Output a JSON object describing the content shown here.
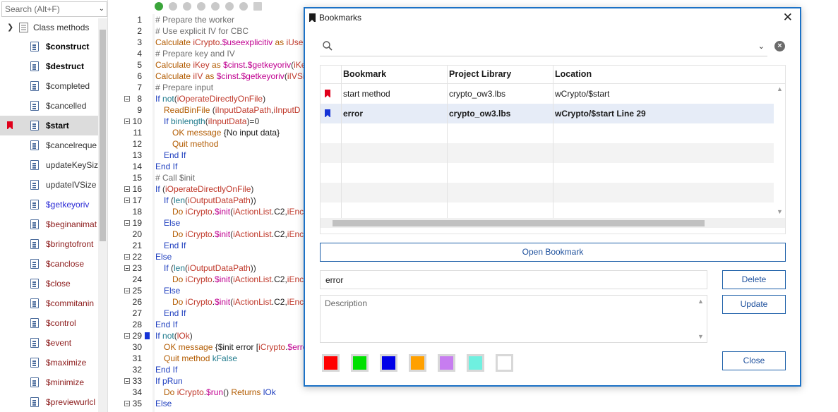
{
  "left_panel": {
    "search_placeholder": "Search (Alt+F)",
    "root_label": "Class methods",
    "items": [
      {
        "label": "$construct",
        "style": "bold"
      },
      {
        "label": "$destruct",
        "style": "bold"
      },
      {
        "label": "$completed",
        "style": "dark"
      },
      {
        "label": "$cancelled",
        "style": "dark"
      },
      {
        "label": "$start",
        "style": "bold",
        "selected": true,
        "bookmark": true
      },
      {
        "label": "$cancelreque",
        "style": "dark"
      },
      {
        "label": "updateKeySiz",
        "style": "dark"
      },
      {
        "label": "updateIVSize",
        "style": "dark"
      },
      {
        "label": "$getkeyoriv",
        "style": "blue"
      },
      {
        "label": "$beginanimat",
        "style": "brown"
      },
      {
        "label": "$bringtofront",
        "style": "brown"
      },
      {
        "label": "$canclose",
        "style": "brown"
      },
      {
        "label": "$close",
        "style": "brown"
      },
      {
        "label": "$commitanin",
        "style": "brown"
      },
      {
        "label": "$control",
        "style": "brown"
      },
      {
        "label": "$event",
        "style": "brown"
      },
      {
        "label": "$maximize",
        "style": "brown"
      },
      {
        "label": "$minimize",
        "style": "brown"
      },
      {
        "label": "$previewurlcl",
        "style": "brown"
      }
    ]
  },
  "editor": {
    "lines": [
      {
        "n": "1",
        "fold": false,
        "indent": 0,
        "tokens": [
          [
            "cm",
            "# Prepare the worker"
          ]
        ]
      },
      {
        "n": "2",
        "fold": false,
        "indent": 0,
        "tokens": [
          [
            "cm",
            "# Use explicit IV for CBC"
          ]
        ]
      },
      {
        "n": "3",
        "fold": false,
        "indent": 0,
        "tokens": [
          [
            "ev",
            "Calculate "
          ],
          [
            "ky",
            "iCrypto"
          ],
          [
            "tx",
            "."
          ],
          [
            "cs",
            "$useexplicitiv"
          ],
          [
            "ev",
            " as "
          ],
          [
            "ky",
            "iUseE"
          ]
        ]
      },
      {
        "n": "4",
        "fold": false,
        "indent": 0,
        "tokens": [
          [
            "cm",
            "# Prepare key and IV"
          ]
        ]
      },
      {
        "n": "5",
        "fold": false,
        "indent": 0,
        "tokens": [
          [
            "ev",
            "Calculate "
          ],
          [
            "ky",
            "iKey"
          ],
          [
            "ev",
            " as "
          ],
          [
            "cs",
            "$cinst"
          ],
          [
            "tx",
            "."
          ],
          [
            "cs",
            "$getkeyoriv"
          ],
          [
            "pn",
            "("
          ],
          [
            "ky",
            "iKe"
          ]
        ]
      },
      {
        "n": "6",
        "fold": false,
        "indent": 0,
        "tokens": [
          [
            "ev",
            "Calculate "
          ],
          [
            "ky",
            "iIV"
          ],
          [
            "ev",
            " as "
          ],
          [
            "cs",
            "$cinst"
          ],
          [
            "tx",
            "."
          ],
          [
            "cs",
            "$getkeyoriv"
          ],
          [
            "pn",
            "("
          ],
          [
            "ky",
            "iIVSi"
          ]
        ]
      },
      {
        "n": "7",
        "fold": false,
        "indent": 0,
        "tokens": [
          [
            "cm",
            "# Prepare input"
          ]
        ]
      },
      {
        "n": "8",
        "fold": true,
        "indent": 0,
        "tokens": [
          [
            "kw",
            "If "
          ],
          [
            "fn",
            "not"
          ],
          [
            "pn",
            "("
          ],
          [
            "ky",
            "iOperateDirectlyOnFile"
          ],
          [
            "pn",
            ")"
          ]
        ]
      },
      {
        "n": "9",
        "fold": false,
        "indent": 1,
        "tokens": [
          [
            "ev",
            "ReadBinFile "
          ],
          [
            "pn",
            "("
          ],
          [
            "ky",
            "iInputDataPath"
          ],
          [
            "pn",
            ","
          ],
          [
            "ky",
            "iInputD"
          ]
        ]
      },
      {
        "n": "10",
        "fold": true,
        "indent": 1,
        "tokens": [
          [
            "kw",
            "If "
          ],
          [
            "fn",
            "binlength"
          ],
          [
            "pn",
            "("
          ],
          [
            "ky",
            "iInputData"
          ],
          [
            "pn",
            ")=0"
          ]
        ]
      },
      {
        "n": "11",
        "fold": false,
        "indent": 2,
        "tokens": [
          [
            "ev",
            "OK message "
          ],
          [
            "tx",
            "{No input data}"
          ]
        ]
      },
      {
        "n": "12",
        "fold": false,
        "indent": 2,
        "tokens": [
          [
            "ev",
            "Quit method"
          ]
        ]
      },
      {
        "n": "13",
        "fold": false,
        "indent": 1,
        "tokens": [
          [
            "kw",
            "End If"
          ]
        ]
      },
      {
        "n": "14",
        "fold": false,
        "indent": 0,
        "tokens": [
          [
            "kw",
            "End If"
          ]
        ]
      },
      {
        "n": "15",
        "fold": false,
        "indent": 0,
        "tokens": [
          [
            "cm",
            "# Call $init"
          ]
        ]
      },
      {
        "n": "16",
        "fold": true,
        "indent": 0,
        "tokens": [
          [
            "kw",
            "If "
          ],
          [
            "pn",
            "("
          ],
          [
            "ky",
            "iOperateDirectlyOnFile"
          ],
          [
            "pn",
            ")"
          ]
        ]
      },
      {
        "n": "17",
        "fold": true,
        "indent": 1,
        "tokens": [
          [
            "kw",
            "If "
          ],
          [
            "pn",
            "("
          ],
          [
            "fn",
            "len"
          ],
          [
            "pn",
            "("
          ],
          [
            "ky",
            "iOutputDataPath"
          ],
          [
            "pn",
            "))"
          ]
        ]
      },
      {
        "n": "18",
        "fold": false,
        "indent": 2,
        "tokens": [
          [
            "ev",
            "Do "
          ],
          [
            "ky",
            "iCrypto"
          ],
          [
            "tx",
            "."
          ],
          [
            "cs",
            "$init"
          ],
          [
            "pn",
            "("
          ],
          [
            "ky",
            "iActionList"
          ],
          [
            "tx",
            ".C2,"
          ],
          [
            "ky",
            "iEnc"
          ]
        ]
      },
      {
        "n": "19",
        "fold": true,
        "indent": 1,
        "tokens": [
          [
            "kw",
            "Else"
          ]
        ]
      },
      {
        "n": "20",
        "fold": false,
        "indent": 2,
        "tokens": [
          [
            "ev",
            "Do "
          ],
          [
            "ky",
            "iCrypto"
          ],
          [
            "tx",
            "."
          ],
          [
            "cs",
            "$init"
          ],
          [
            "pn",
            "("
          ],
          [
            "ky",
            "iActionList"
          ],
          [
            "tx",
            ".C2,"
          ],
          [
            "ky",
            "iEnc"
          ]
        ]
      },
      {
        "n": "21",
        "fold": false,
        "indent": 1,
        "tokens": [
          [
            "kw",
            "End If"
          ]
        ]
      },
      {
        "n": "22",
        "fold": true,
        "indent": 0,
        "tokens": [
          [
            "kw",
            "Else"
          ]
        ]
      },
      {
        "n": "23",
        "fold": true,
        "indent": 1,
        "tokens": [
          [
            "kw",
            "If "
          ],
          [
            "pn",
            "("
          ],
          [
            "fn",
            "len"
          ],
          [
            "pn",
            "("
          ],
          [
            "ky",
            "iOutputDataPath"
          ],
          [
            "pn",
            "))"
          ]
        ]
      },
      {
        "n": "24",
        "fold": false,
        "indent": 2,
        "tokens": [
          [
            "ev",
            "Do "
          ],
          [
            "ky",
            "iCrypto"
          ],
          [
            "tx",
            "."
          ],
          [
            "cs",
            "$init"
          ],
          [
            "pn",
            "("
          ],
          [
            "ky",
            "iActionList"
          ],
          [
            "tx",
            ".C2,"
          ],
          [
            "ky",
            "iEnc"
          ]
        ]
      },
      {
        "n": "25",
        "fold": true,
        "indent": 1,
        "tokens": [
          [
            "kw",
            "Else"
          ]
        ]
      },
      {
        "n": "26",
        "fold": false,
        "indent": 2,
        "tokens": [
          [
            "ev",
            "Do "
          ],
          [
            "ky",
            "iCrypto"
          ],
          [
            "tx",
            "."
          ],
          [
            "cs",
            "$init"
          ],
          [
            "pn",
            "("
          ],
          [
            "ky",
            "iActionList"
          ],
          [
            "tx",
            ".C2,"
          ],
          [
            "ky",
            "iEnc"
          ]
        ]
      },
      {
        "n": "27",
        "fold": false,
        "indent": 1,
        "tokens": [
          [
            "kw",
            "End If"
          ]
        ]
      },
      {
        "n": "28",
        "fold": false,
        "indent": 0,
        "tokens": [
          [
            "kw",
            "End If"
          ]
        ]
      },
      {
        "n": "29",
        "fold": true,
        "indent": 0,
        "bookmark": true,
        "tokens": [
          [
            "kw",
            "If "
          ],
          [
            "fn",
            "not"
          ],
          [
            "pn",
            "("
          ],
          [
            "ky",
            "lOk"
          ],
          [
            "pn",
            ")"
          ]
        ]
      },
      {
        "n": "30",
        "fold": false,
        "indent": 1,
        "tokens": [
          [
            "ev",
            "OK message "
          ],
          [
            "tx",
            "{$init error ["
          ],
          [
            "ky",
            "iCrypto"
          ],
          [
            "tx",
            "."
          ],
          [
            "cs",
            "$erro"
          ]
        ]
      },
      {
        "n": "31",
        "fold": false,
        "indent": 1,
        "tokens": [
          [
            "ev",
            "Quit method "
          ],
          [
            "fn",
            "kFalse"
          ]
        ]
      },
      {
        "n": "32",
        "fold": false,
        "indent": 0,
        "tokens": [
          [
            "kw",
            "End If"
          ]
        ]
      },
      {
        "n": "33",
        "fold": true,
        "indent": 0,
        "tokens": [
          [
            "kw",
            "If "
          ],
          [
            "kw",
            "pRun"
          ]
        ]
      },
      {
        "n": "34",
        "fold": false,
        "indent": 1,
        "tokens": [
          [
            "ev",
            "Do "
          ],
          [
            "ky",
            "iCrypto"
          ],
          [
            "tx",
            "."
          ],
          [
            "cs",
            "$run"
          ],
          [
            "pn",
            "() "
          ],
          [
            "ev",
            "Returns "
          ],
          [
            "kw",
            "lOk"
          ]
        ]
      },
      {
        "n": "35",
        "fold": true,
        "indent": 0,
        "tokens": [
          [
            "kw",
            "Else"
          ]
        ]
      }
    ]
  },
  "dialog": {
    "title": "Bookmarks",
    "search_value": "",
    "columns": {
      "bookmark": "Bookmark",
      "library": "Project Library",
      "location": "Location"
    },
    "rows": [
      {
        "color": "#e0001b",
        "bookmark": "start method",
        "library": "crypto_ow3.lbs",
        "location": "wCrypto/$start",
        "selected": false
      },
      {
        "color": "#1533d6",
        "bookmark": "error",
        "library": "crypto_ow3.lbs",
        "location": "wCrypto/$start Line 29",
        "selected": true
      }
    ],
    "open_button": "Open Bookmark",
    "name_value": "error",
    "description_placeholder": "Description",
    "delete_button": "Delete",
    "update_button": "Update",
    "close_button": "Close",
    "swatches": [
      "#ff0000",
      "#00e000",
      "#0000e8",
      "#ffa000",
      "#c77df0",
      "#6ff0e0",
      "#ffffff"
    ]
  }
}
